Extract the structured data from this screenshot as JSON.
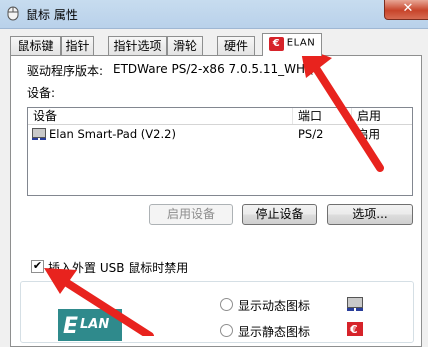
{
  "window": {
    "title": "鼠标 属性",
    "close_label": "✕"
  },
  "tabs": [
    {
      "label": "鼠标键"
    },
    {
      "label": "指针"
    },
    {
      "label": "指针选项"
    },
    {
      "label": "滑轮"
    },
    {
      "label": "硬件"
    },
    {
      "label": "ELAN",
      "logo_letter": "€",
      "active": true
    }
  ],
  "driver": {
    "label": "驱动程序版本:",
    "value": "ETDWare PS/2-x86 7.0.5.11_WHQL"
  },
  "devices": {
    "label": "设备:",
    "columns": [
      "设备",
      "端口",
      "启用"
    ],
    "rows": [
      {
        "name": "Elan Smart-Pad  (V2.2)",
        "port": "PS/2",
        "enabled": "启用"
      }
    ]
  },
  "buttons": {
    "enable": "启用设备",
    "disable": "停止设备",
    "options": "选项..."
  },
  "usb_checkbox": {
    "label": "插入外置 USB 鼠标时禁用",
    "checked": "✔"
  },
  "tray_icon": {
    "show_dynamic": "显示动态图标",
    "show_static": "显示静态图标"
  },
  "logo_text": "LAN",
  "colors": {
    "arrow": "#e8231e",
    "elan_red": "#d6232a",
    "elan_teal": "#2f8a8c"
  }
}
